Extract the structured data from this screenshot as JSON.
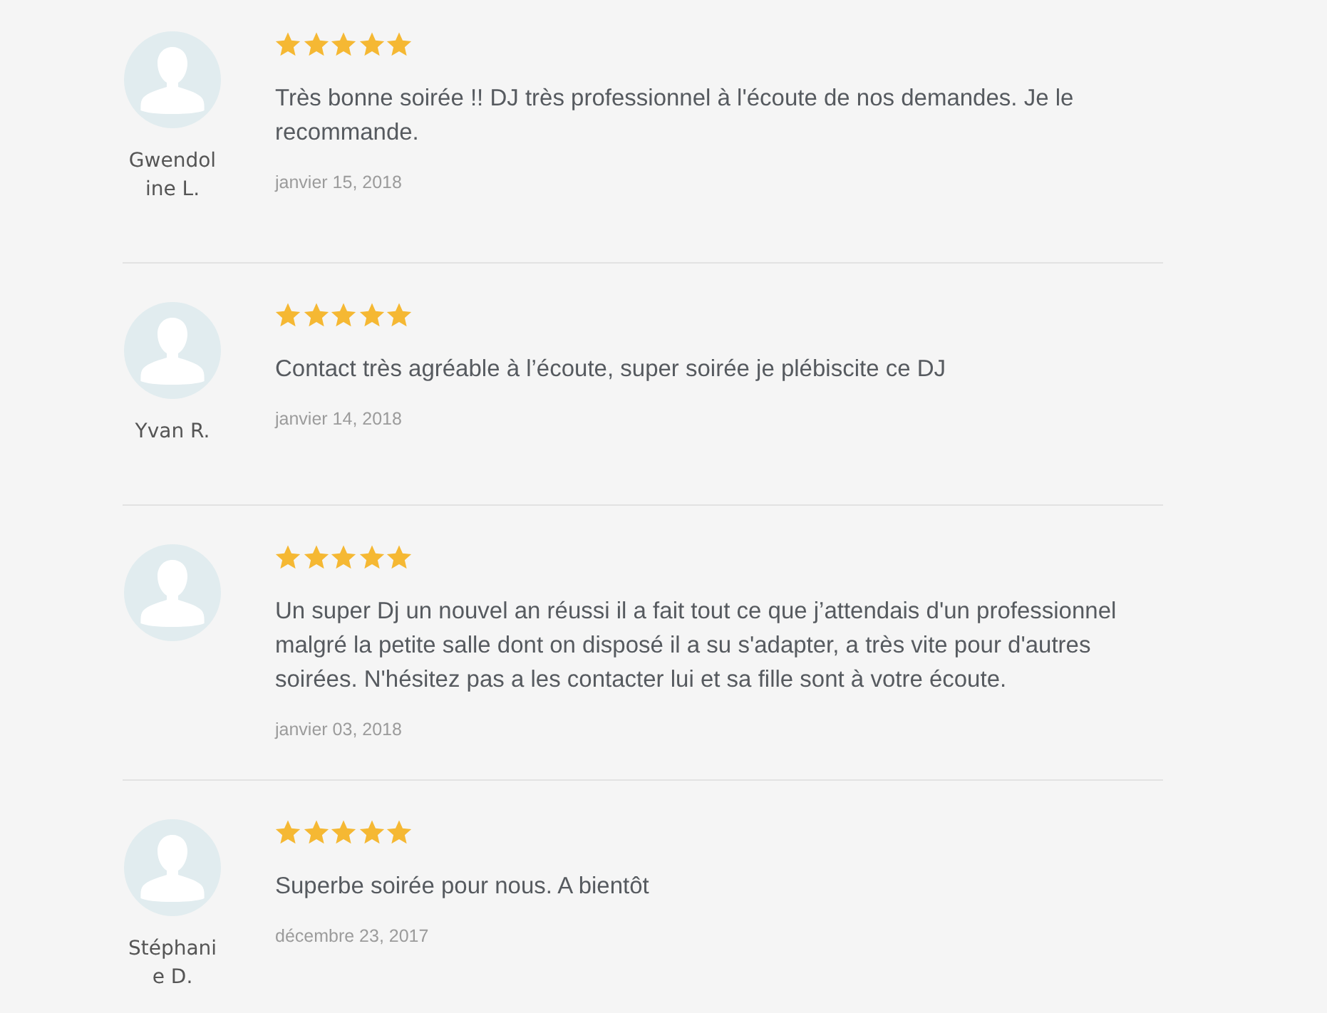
{
  "reviews": [
    {
      "author": "Gwendoline L.",
      "stars": 5,
      "text": "Très bonne soirée !! DJ très professionnel à l'écoute de nos demandes. Je le recommande.",
      "date": "janvier 15, 2018"
    },
    {
      "author": "Yvan R.",
      "stars": 5,
      "text": "Contact très agréable à l’écoute, super soirée je plébiscite ce DJ",
      "date": "janvier 14, 2018"
    },
    {
      "stars": 5,
      "text": "Un super Dj un nouvel an réussi il a fait tout ce que j’attendais d'un professionnel malgré la petite salle dont on disposé il a su s'adapter, a très vite pour d'autres soirées. N'hésitez pas a les contacter lui et sa fille sont à votre écoute.",
      "date": "janvier 03, 2018"
    },
    {
      "author": "Stéphanie D.",
      "stars": 5,
      "text": "Superbe soirée pour nous. A bientôt",
      "date": "décembre 23, 2017"
    }
  ]
}
